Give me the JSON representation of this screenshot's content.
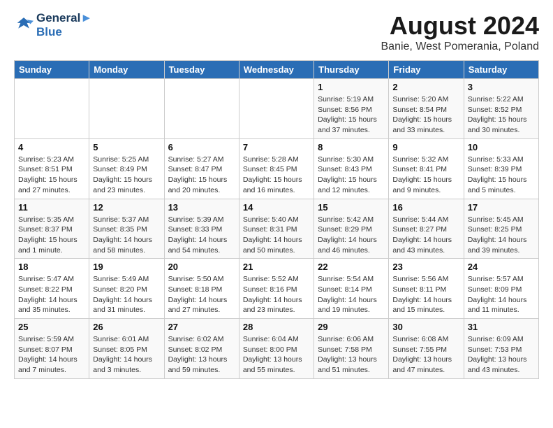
{
  "header": {
    "logo_line1": "General",
    "logo_line2": "Blue",
    "title": "August 2024",
    "subtitle": "Banie, West Pomerania, Poland"
  },
  "days_of_week": [
    "Sunday",
    "Monday",
    "Tuesday",
    "Wednesday",
    "Thursday",
    "Friday",
    "Saturday"
  ],
  "weeks": [
    [
      {
        "day": "",
        "info": ""
      },
      {
        "day": "",
        "info": ""
      },
      {
        "day": "",
        "info": ""
      },
      {
        "day": "",
        "info": ""
      },
      {
        "day": "1",
        "info": "Sunrise: 5:19 AM\nSunset: 8:56 PM\nDaylight: 15 hours\nand 37 minutes."
      },
      {
        "day": "2",
        "info": "Sunrise: 5:20 AM\nSunset: 8:54 PM\nDaylight: 15 hours\nand 33 minutes."
      },
      {
        "day": "3",
        "info": "Sunrise: 5:22 AM\nSunset: 8:52 PM\nDaylight: 15 hours\nand 30 minutes."
      }
    ],
    [
      {
        "day": "4",
        "info": "Sunrise: 5:23 AM\nSunset: 8:51 PM\nDaylight: 15 hours\nand 27 minutes."
      },
      {
        "day": "5",
        "info": "Sunrise: 5:25 AM\nSunset: 8:49 PM\nDaylight: 15 hours\nand 23 minutes."
      },
      {
        "day": "6",
        "info": "Sunrise: 5:27 AM\nSunset: 8:47 PM\nDaylight: 15 hours\nand 20 minutes."
      },
      {
        "day": "7",
        "info": "Sunrise: 5:28 AM\nSunset: 8:45 PM\nDaylight: 15 hours\nand 16 minutes."
      },
      {
        "day": "8",
        "info": "Sunrise: 5:30 AM\nSunset: 8:43 PM\nDaylight: 15 hours\nand 12 minutes."
      },
      {
        "day": "9",
        "info": "Sunrise: 5:32 AM\nSunset: 8:41 PM\nDaylight: 15 hours\nand 9 minutes."
      },
      {
        "day": "10",
        "info": "Sunrise: 5:33 AM\nSunset: 8:39 PM\nDaylight: 15 hours\nand 5 minutes."
      }
    ],
    [
      {
        "day": "11",
        "info": "Sunrise: 5:35 AM\nSunset: 8:37 PM\nDaylight: 15 hours\nand 1 minute."
      },
      {
        "day": "12",
        "info": "Sunrise: 5:37 AM\nSunset: 8:35 PM\nDaylight: 14 hours\nand 58 minutes."
      },
      {
        "day": "13",
        "info": "Sunrise: 5:39 AM\nSunset: 8:33 PM\nDaylight: 14 hours\nand 54 minutes."
      },
      {
        "day": "14",
        "info": "Sunrise: 5:40 AM\nSunset: 8:31 PM\nDaylight: 14 hours\nand 50 minutes."
      },
      {
        "day": "15",
        "info": "Sunrise: 5:42 AM\nSunset: 8:29 PM\nDaylight: 14 hours\nand 46 minutes."
      },
      {
        "day": "16",
        "info": "Sunrise: 5:44 AM\nSunset: 8:27 PM\nDaylight: 14 hours\nand 43 minutes."
      },
      {
        "day": "17",
        "info": "Sunrise: 5:45 AM\nSunset: 8:25 PM\nDaylight: 14 hours\nand 39 minutes."
      }
    ],
    [
      {
        "day": "18",
        "info": "Sunrise: 5:47 AM\nSunset: 8:22 PM\nDaylight: 14 hours\nand 35 minutes."
      },
      {
        "day": "19",
        "info": "Sunrise: 5:49 AM\nSunset: 8:20 PM\nDaylight: 14 hours\nand 31 minutes."
      },
      {
        "day": "20",
        "info": "Sunrise: 5:50 AM\nSunset: 8:18 PM\nDaylight: 14 hours\nand 27 minutes."
      },
      {
        "day": "21",
        "info": "Sunrise: 5:52 AM\nSunset: 8:16 PM\nDaylight: 14 hours\nand 23 minutes."
      },
      {
        "day": "22",
        "info": "Sunrise: 5:54 AM\nSunset: 8:14 PM\nDaylight: 14 hours\nand 19 minutes."
      },
      {
        "day": "23",
        "info": "Sunrise: 5:56 AM\nSunset: 8:11 PM\nDaylight: 14 hours\nand 15 minutes."
      },
      {
        "day": "24",
        "info": "Sunrise: 5:57 AM\nSunset: 8:09 PM\nDaylight: 14 hours\nand 11 minutes."
      }
    ],
    [
      {
        "day": "25",
        "info": "Sunrise: 5:59 AM\nSunset: 8:07 PM\nDaylight: 14 hours\nand 7 minutes."
      },
      {
        "day": "26",
        "info": "Sunrise: 6:01 AM\nSunset: 8:05 PM\nDaylight: 14 hours\nand 3 minutes."
      },
      {
        "day": "27",
        "info": "Sunrise: 6:02 AM\nSunset: 8:02 PM\nDaylight: 13 hours\nand 59 minutes."
      },
      {
        "day": "28",
        "info": "Sunrise: 6:04 AM\nSunset: 8:00 PM\nDaylight: 13 hours\nand 55 minutes."
      },
      {
        "day": "29",
        "info": "Sunrise: 6:06 AM\nSunset: 7:58 PM\nDaylight: 13 hours\nand 51 minutes."
      },
      {
        "day": "30",
        "info": "Sunrise: 6:08 AM\nSunset: 7:55 PM\nDaylight: 13 hours\nand 47 minutes."
      },
      {
        "day": "31",
        "info": "Sunrise: 6:09 AM\nSunset: 7:53 PM\nDaylight: 13 hours\nand 43 minutes."
      }
    ]
  ]
}
